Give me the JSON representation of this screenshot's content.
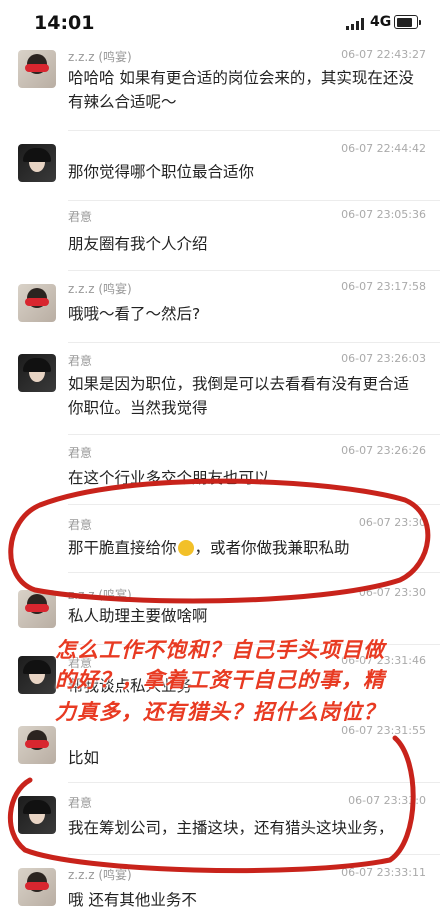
{
  "status": {
    "time": "14:01",
    "network": "4G"
  },
  "messages": [
    {
      "sender": "z.z.z (鸣宴)",
      "avatar": "zzz",
      "time": "06-07 22:43:27",
      "text": "哈哈哈 如果有更合适的岗位会来的，其实现在还没有辣么合适呢～"
    },
    {
      "sender": "君意",
      "avatar": "jy",
      "time": "06-07 22:44:42",
      "text": "那你觉得哪个职位最合适你"
    },
    {
      "sender": "君意",
      "avatar": "jy",
      "time": "06-07 23:05:36",
      "text": "朋友圈有我个人介绍"
    },
    {
      "sender": "z.z.z (鸣宴)",
      "avatar": "zzz",
      "time": "06-07 23:17:58",
      "text": "哦哦～看了～然后?"
    },
    {
      "sender": "君意",
      "avatar": "jy",
      "time": "06-07 23:26:03",
      "text": "如果是因为职位，我倒是可以去看看有没有更合适你职位。当然我觉得"
    },
    {
      "sender": "君意",
      "avatar": "jy",
      "time": "06-07 23:26:26",
      "text": "在这个行业多交个朋友也可以"
    },
    {
      "sender": "君意",
      "avatar": "jy",
      "time": "06-07 23:30",
      "text_before": "那干脆直接给你",
      "emoji": "grimace-emoji",
      "text_after": "，或者你做我兼职私助"
    },
    {
      "sender": "z.z.z (鸣宴)",
      "avatar": "zzz",
      "time": "06-07 23:30",
      "text": "私人助理主要做啥啊"
    },
    {
      "sender": "君意",
      "avatar": "jy",
      "time": "06-07 23:31:46",
      "text": "帮我谈点私人业务"
    },
    {
      "sender": "z.z.z (鸣宴)",
      "avatar": "zzz",
      "time": "06-07 23:31:55",
      "text": "比如"
    },
    {
      "sender": "君意",
      "avatar": "jy",
      "time": "06-07 23:33:0",
      "text": "我在筹划公司，主播这块，还有猎头这块业务，"
    },
    {
      "sender": "z.z.z (鸣宴)",
      "avatar": "zzz",
      "time": "06-07 23:33:11",
      "text": "哦 还有其他业务不"
    }
  ],
  "annotation": {
    "line1": "怎么工作不饱和？自己手头项目做",
    "line2": "的好？，拿着工资干自己的事，精",
    "line3": "力真多，还有猎头？招什么岗位？",
    "color": "#e83a22"
  }
}
